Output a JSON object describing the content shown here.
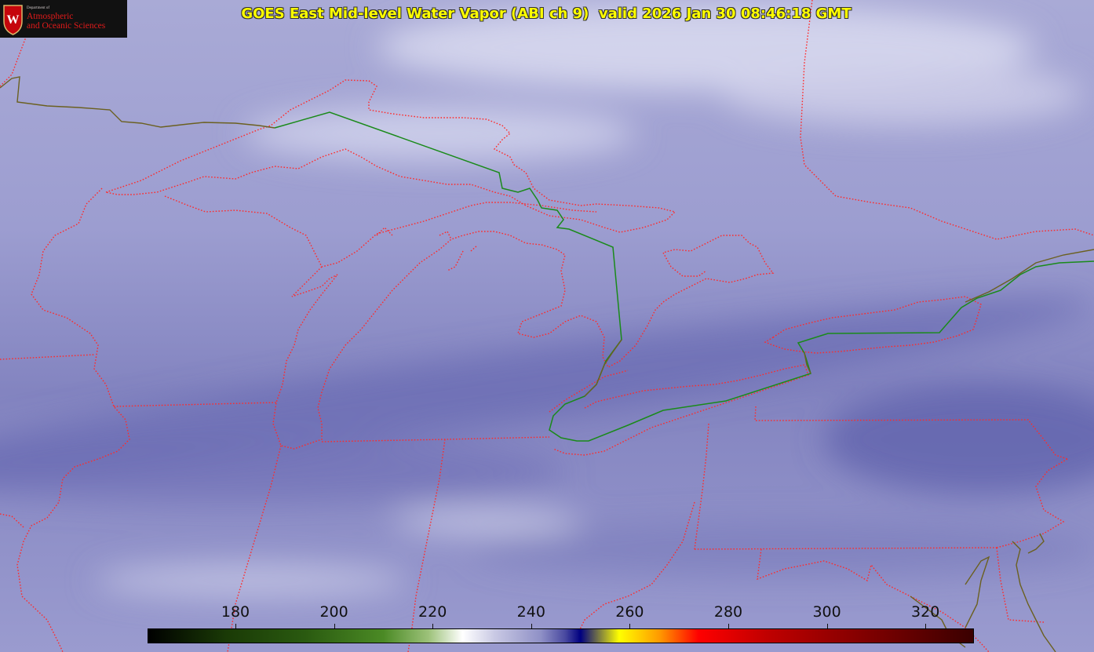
{
  "logo": {
    "crest_letter": "W",
    "department": "Department of",
    "line1": "Atmospheric",
    "line2": "and Oceanic Sciences"
  },
  "title": "GOES East Mid-level Water Vapor (ABI ch 9)  valid 2026 Jan 30 08:46:18 GMT",
  "colorbar": {
    "ticks": [
      "180",
      "200",
      "220",
      "240",
      "260",
      "280",
      "300",
      "320"
    ]
  },
  "colors": {
    "background": "#8b8cc4",
    "state_borders": "#ff2a2a",
    "international_border": "#1a8a1a",
    "coastline": "#6b6020",
    "title_text": "#ffff00"
  }
}
